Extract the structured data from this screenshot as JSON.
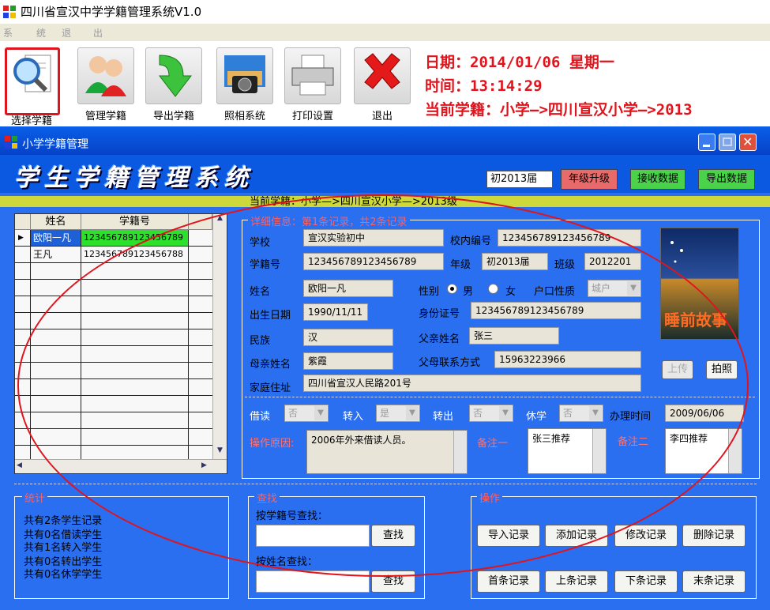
{
  "app": {
    "title": "四川省宣汉中学学籍管理系统V1.0"
  },
  "menu": [
    "系",
    "统",
    "退",
    "出"
  ],
  "toolbar": {
    "buttons": [
      {
        "label": "选择学籍",
        "icon": "magnifier-document-icon"
      },
      {
        "label": "管理学籍",
        "icon": "users-icon"
      },
      {
        "label": "导出学籍",
        "icon": "green-down-arrow-icon"
      },
      {
        "label": "照相系统",
        "icon": "camera-photo-icon"
      },
      {
        "label": "打印设置",
        "icon": "printer-icon"
      },
      {
        "label": "退出",
        "icon": "red-x-icon"
      }
    ],
    "date_line": "日期：2014/01/06  星期一",
    "time_line": "时间：13:14:29",
    "current_line": "当前学籍：小学—>四川宣汉小学—>2013"
  },
  "inner_window": {
    "title": "小学学籍管理",
    "banner": "学生学籍管理系统",
    "grade_value": "初2013届",
    "btn_upgrade": "年级升级",
    "btn_receive": "接收数据",
    "btn_export": "导出数据",
    "current_label": "当前学籍：小学—>四川宣汉小学—>2013级"
  },
  "grid": {
    "headers": [
      "姓名",
      "学籍号"
    ],
    "rows": [
      {
        "name": "欧阳一凡",
        "id": "123456789123456789"
      },
      {
        "name": "王凡",
        "id": "123456789123456788"
      }
    ]
  },
  "detail": {
    "title": "详细信息：第1条记录，共2条记录",
    "school_label": "学校",
    "school": "宣汉实验初中",
    "school_no_label": "校内编号",
    "school_no": "123456789123456789",
    "student_id_label": "学籍号",
    "student_id": "123456789123456789",
    "grade_label": "年级",
    "grade": "初2013届",
    "class_label": "班级",
    "class": "2012201",
    "name_label": "姓名",
    "name": "欧阳一凡",
    "gender_label": "性别",
    "gender_male": "男",
    "gender_female": "女",
    "hukou_label": "户口性质",
    "hukou": "城户",
    "birth_label": "出生日期",
    "birth": "1990/11/11",
    "idcard_label": "身份证号",
    "idcard": "123456789123456789",
    "ethnic_label": "民族",
    "ethnic": "汉",
    "father_label": "父亲姓名",
    "father": "张三",
    "mother_label": "母亲姓名",
    "mother": "紫霞",
    "contact_label": "父母联系方式",
    "contact": "15963223966",
    "address_label": "家庭住址",
    "address": "四川省宣汉人民路201号",
    "btn_upload": "上传",
    "btn_photo": "拍照",
    "photo_caption": "睡前故事"
  },
  "status": {
    "borrow_label": "借读",
    "borrow": "否",
    "transfer_in_label": "转入",
    "transfer_in": "是",
    "transfer_out_label": "转出",
    "transfer_out": "否",
    "suspend_label": "休学",
    "suspend": "否",
    "handle_time_label": "办理时间",
    "handle_time": "2009/06/06",
    "reason_label": "操作原因:",
    "reason": "2006年外来借读人员。",
    "note1_label": "备注一",
    "note1": "张三推荐",
    "note2_label": "备注二",
    "note2": "李四推荐"
  },
  "stats": {
    "title": "统计",
    "lines": [
      "共有2条学生记录",
      "共有0名借读学生",
      "共有1名转入学生",
      "共有0名转出学生",
      "共有0名休学学生"
    ]
  },
  "search": {
    "title": "查找",
    "by_id_label": "按学籍号查找：",
    "by_name_label": "按姓名查找：",
    "btn": "查找"
  },
  "ops": {
    "title": "操作",
    "import": "导入记录",
    "add": "添加记录",
    "edit": "修改记录",
    "delete": "删除记录",
    "first": "首条记录",
    "prev": "上条记录",
    "next": "下条记录",
    "last": "末条记录"
  }
}
